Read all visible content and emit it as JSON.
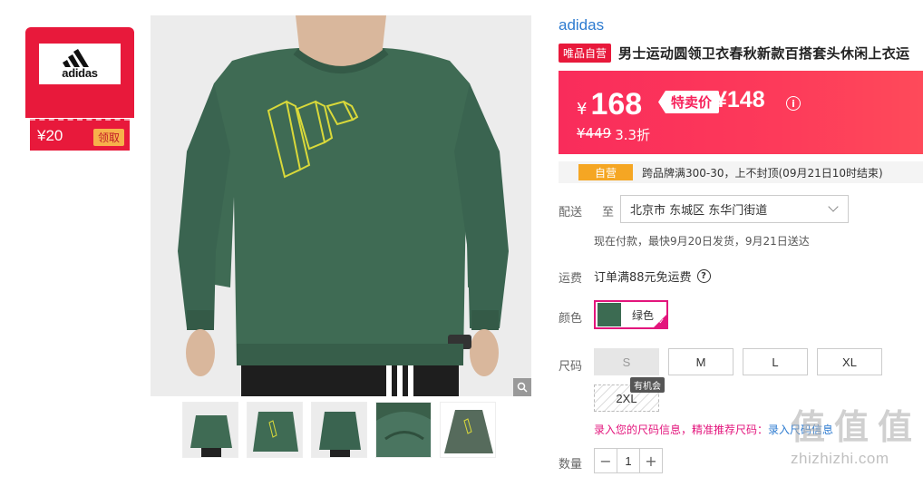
{
  "coupon": {
    "brand_logo_text": "adidas",
    "amount": "¥20",
    "claim_label": "领取"
  },
  "product": {
    "brand": "adidas",
    "self_badge": "唯品自营",
    "title": "男士运动圆领卫衣春秋新款百搭套头休闲上衣运",
    "image_icon": "green-sweatshirt-image",
    "thumbnail_count": 5
  },
  "price": {
    "current_symbol": "¥",
    "current": "168",
    "special_label": "特卖价",
    "special_price": "¥148",
    "original": "¥449",
    "discount": "3.3折",
    "accent_color": "#f92c5b"
  },
  "promo": {
    "tag": "自营",
    "text": "跨品牌满300-30，上不封顶(09月21日10时结束)"
  },
  "delivery": {
    "label": "配送",
    "to_label": "至",
    "address": "北京市 东城区 东华门街道",
    "note": "现在付款，最快9月20日发货，9月21日送达"
  },
  "shipping": {
    "label": "运费",
    "value": "订单满88元免运费"
  },
  "color": {
    "label": "颜色",
    "selected": "绿色",
    "accent_color": "#e3157c"
  },
  "size": {
    "label": "尺码",
    "options": [
      "S",
      "M",
      "L",
      "XL"
    ],
    "disabled": "S",
    "option_2xl": "2XL",
    "chance_tag": "有机会",
    "hint": "录入您的尺码信息，精准推荐尺码：",
    "hint_link": "录入尺码信息"
  },
  "quantity": {
    "label": "数量",
    "value": "1"
  },
  "watermark": {
    "chars": [
      "值",
      "值",
      "值"
    ],
    "url": "zhizhizhi.com"
  }
}
